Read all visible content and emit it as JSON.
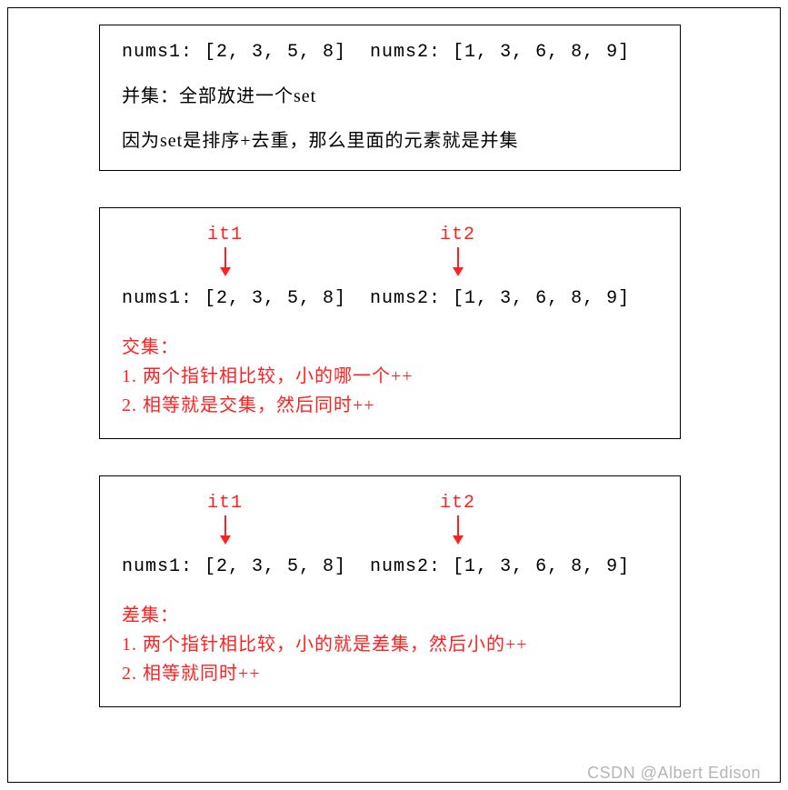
{
  "panel1": {
    "arrays_line": "nums1: [2, 3, 5, 8]  nums2: [1, 3, 6, 8, 9]",
    "line1": "并集：全部放进一个set",
    "line2": "因为set是排序+去重，那么里面的元素就是并集"
  },
  "panel2": {
    "ptr1": "it1",
    "ptr2": "it2",
    "arrays_line": "nums1: [2, 3, 5, 8]  nums2: [1, 3, 6, 8, 9]",
    "title": "交集：",
    "rule1": "1. 两个指针相比较，小的哪一个++",
    "rule2": "2. 相等就是交集，然后同时++"
  },
  "panel3": {
    "ptr1": "it1",
    "ptr2": "it2",
    "arrays_line": "nums1: [2, 3, 5, 8]  nums2: [1, 3, 6, 8, 9]",
    "title": "差集：",
    "rule1": "1. 两个指针相比较，小的就是差集，然后小的++",
    "rule2": "2. 相等就同时++"
  },
  "watermark": "CSDN @Albert Edison"
}
